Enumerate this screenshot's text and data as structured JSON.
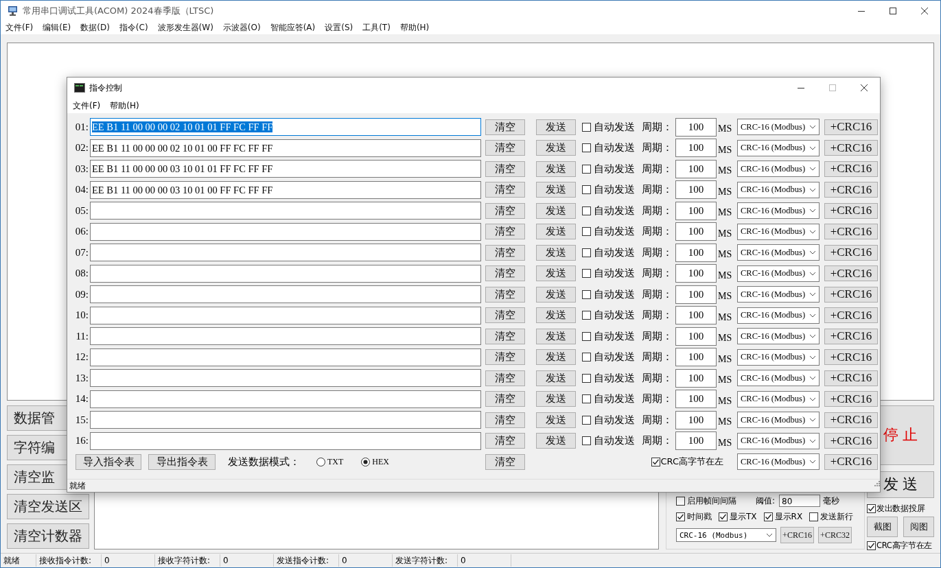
{
  "window": {
    "title": "常用串口调试工具(ACOM) 2024春季版（LTSC)"
  },
  "menu": [
    "文件(F)",
    "编辑(E)",
    "数据(D)",
    "指令(C)",
    "波形发生器(W)",
    "示波器(O)",
    "智能应答(A)",
    "设置(S)",
    "工具(T)",
    "帮助(H)"
  ],
  "left_buttons": [
    "数据管",
    "字符编",
    "清空监",
    "清空发送区",
    "清空计数器"
  ],
  "options": {
    "frame_gap": {
      "label": "启用帧间间隔",
      "checked": false
    },
    "threshold_label": "阈值:",
    "threshold": "80",
    "threshold_unit": "毫秒",
    "checks": [
      {
        "label": "时间戳",
        "checked": true
      },
      {
        "label": "显示TX",
        "checked": true
      },
      {
        "label": "显示RX",
        "checked": true
      },
      {
        "label": "发送新行",
        "checked": false
      }
    ],
    "crc_select": "CRC-16 (Modbus)",
    "buttons": [
      "+CRC16",
      "+CRC32"
    ]
  },
  "side": {
    "stop": "停 止",
    "send": "发 送",
    "mirror": {
      "label": "发出数据投屏",
      "checked": true
    },
    "buttons": [
      "截图",
      "阅图"
    ],
    "crc_high": {
      "label": "CRC高字节在左",
      "checked": true
    }
  },
  "status_bar": [
    {
      "label": "就绪"
    },
    {
      "label": "接收指令计数:",
      "value": "0"
    },
    {
      "label": "接收字符计数:",
      "value": "0"
    },
    {
      "label": "发送指令计数:",
      "value": "0"
    },
    {
      "label": "发送字符计数:",
      "value": "0"
    }
  ],
  "dialog": {
    "title": "指令控制",
    "menu": [
      "文件(F)",
      "帮助(H)"
    ],
    "rows": [
      {
        "label": "01:",
        "value": "EE B1 11 00 00 00 02 10 01 01 FF FC FF FF",
        "focused": true,
        "clear": "清空",
        "send": "发送",
        "auto_send": false,
        "auto_label": "自动发送",
        "period_label": "周期：",
        "period": "100",
        "unit": "MS",
        "crc": "CRC-16 (Modbus)",
        "crc_button": "+CRC16"
      },
      {
        "label": "02:",
        "value": "EE B1 11 00 00 00 02 10 01 00 FF FC FF FF",
        "focused": false,
        "clear": "清空",
        "send": "发送",
        "auto_send": false,
        "auto_label": "自动发送",
        "period_label": "周期：",
        "period": "100",
        "unit": "MS",
        "crc": "CRC-16 (Modbus)",
        "crc_button": "+CRC16"
      },
      {
        "label": "03:",
        "value": "EE B1 11 00 00 00 03 10 01 01 FF FC FF FF",
        "focused": false,
        "clear": "清空",
        "send": "发送",
        "auto_send": false,
        "auto_label": "自动发送",
        "period_label": "周期：",
        "period": "100",
        "unit": "MS",
        "crc": "CRC-16 (Modbus)",
        "crc_button": "+CRC16"
      },
      {
        "label": "04:",
        "value": "EE B1 11 00 00 00 03 10 01 00 FF FC FF FF",
        "focused": false,
        "clear": "清空",
        "send": "发送",
        "auto_send": false,
        "auto_label": "自动发送",
        "period_label": "周期：",
        "period": "100",
        "unit": "MS",
        "crc": "CRC-16 (Modbus)",
        "crc_button": "+CRC16"
      },
      {
        "label": "05:",
        "focused": false,
        "clear": "清空",
        "send": "发送",
        "auto_send": false,
        "auto_label": "自动发送",
        "period_label": "周期：",
        "period": "100",
        "unit": "MS",
        "crc": "CRC-16 (Modbus)",
        "crc_button": "+CRC16"
      },
      {
        "label": "06:",
        "focused": false,
        "clear": "清空",
        "send": "发送",
        "auto_send": false,
        "auto_label": "自动发送",
        "period_label": "周期：",
        "period": "100",
        "unit": "MS",
        "crc": "CRC-16 (Modbus)",
        "crc_button": "+CRC16"
      },
      {
        "label": "07:",
        "focused": false,
        "clear": "清空",
        "send": "发送",
        "auto_send": false,
        "auto_label": "自动发送",
        "period_label": "周期：",
        "period": "100",
        "unit": "MS",
        "crc": "CRC-16 (Modbus)",
        "crc_button": "+CRC16"
      },
      {
        "label": "08:",
        "focused": false,
        "clear": "清空",
        "send": "发送",
        "auto_send": false,
        "auto_label": "自动发送",
        "period_label": "周期：",
        "period": "100",
        "unit": "MS",
        "crc": "CRC-16 (Modbus)",
        "crc_button": "+CRC16"
      },
      {
        "label": "09:",
        "focused": false,
        "clear": "清空",
        "send": "发送",
        "auto_send": false,
        "auto_label": "自动发送",
        "period_label": "周期：",
        "period": "100",
        "unit": "MS",
        "crc": "CRC-16 (Modbus)",
        "crc_button": "+CRC16"
      },
      {
        "label": "10:",
        "focused": false,
        "clear": "清空",
        "send": "发送",
        "auto_send": false,
        "auto_label": "自动发送",
        "period_label": "周期：",
        "period": "100",
        "unit": "MS",
        "crc": "CRC-16 (Modbus)",
        "crc_button": "+CRC16"
      },
      {
        "label": "11:",
        "focused": false,
        "clear": "清空",
        "send": "发送",
        "auto_send": false,
        "auto_label": "自动发送",
        "period_label": "周期：",
        "period": "100",
        "unit": "MS",
        "crc": "CRC-16 (Modbus)",
        "crc_button": "+CRC16"
      },
      {
        "label": "12:",
        "focused": false,
        "clear": "清空",
        "send": "发送",
        "auto_send": false,
        "auto_label": "自动发送",
        "period_label": "周期：",
        "period": "100",
        "unit": "MS",
        "crc": "CRC-16 (Modbus)",
        "crc_button": "+CRC16"
      },
      {
        "label": "13:",
        "focused": false,
        "clear": "清空",
        "send": "发送",
        "auto_send": false,
        "auto_label": "自动发送",
        "period_label": "周期：",
        "period": "100",
        "unit": "MS",
        "crc": "CRC-16 (Modbus)",
        "crc_button": "+CRC16"
      },
      {
        "label": "14:",
        "focused": false,
        "clear": "清空",
        "send": "发送",
        "auto_send": false,
        "auto_label": "自动发送",
        "period_label": "周期：",
        "period": "100",
        "unit": "MS",
        "crc": "CRC-16 (Modbus)",
        "crc_button": "+CRC16"
      },
      {
        "label": "15:",
        "focused": false,
        "clear": "清空",
        "send": "发送",
        "auto_send": false,
        "auto_label": "自动发送",
        "period_label": "周期：",
        "period": "100",
        "unit": "MS",
        "crc": "CRC-16 (Modbus)",
        "crc_button": "+CRC16"
      },
      {
        "label": "16:",
        "focused": false,
        "clear": "清空",
        "send": "发送",
        "auto_send": false,
        "auto_label": "自动发送",
        "period_label": "周期：",
        "period": "100",
        "unit": "MS",
        "crc": "CRC-16 (Modbus)",
        "crc_button": "+CRC16"
      }
    ],
    "footer": {
      "import": "导入指令表",
      "export": "导出指令表",
      "mode_label": "发送数据模式：",
      "modes": [
        {
          "label": "TXT",
          "selected": false
        },
        {
          "label": "HEX",
          "selected": true
        }
      ],
      "clear": "清空",
      "crc_high": {
        "label": "CRC高字节在左",
        "checked": true
      },
      "crc": "CRC-16 (Modbus)",
      "crc_button": "+CRC16"
    },
    "status": "就绪"
  }
}
